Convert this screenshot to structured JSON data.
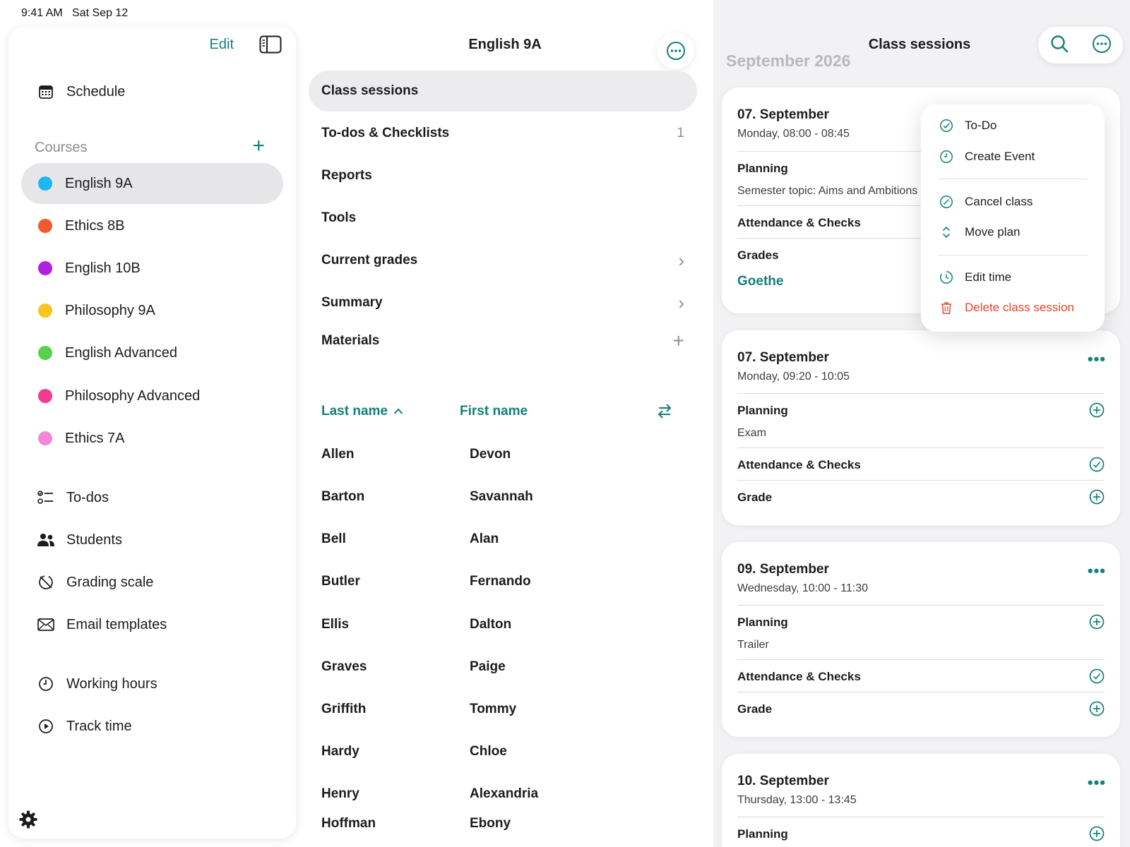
{
  "status": {
    "time": "9:41 AM",
    "date": "Sat Sep 12"
  },
  "sidebar": {
    "edit_label": "Edit",
    "schedule_label": "Schedule",
    "courses_heading": "Courses",
    "add_symbol": "+",
    "courses": [
      {
        "label": "English 9A",
        "color": "#1fb6f5"
      },
      {
        "label": "Ethics 8B",
        "color": "#f15a2e"
      },
      {
        "label": "English 10B",
        "color": "#b21fe0"
      },
      {
        "label": "Philosophy 9A",
        "color": "#f8c51b"
      },
      {
        "label": "English Advanced",
        "color": "#57d04b"
      },
      {
        "label": "Philosophy Advanced",
        "color": "#f13b8c"
      },
      {
        "label": "Ethics 7A",
        "color": "#f586d9"
      }
    ],
    "tools": [
      {
        "label": "To-dos",
        "icon": "checklist-icon"
      },
      {
        "label": "Students",
        "icon": "people-icon"
      },
      {
        "label": "Grading scale",
        "icon": "grading-scale-icon"
      },
      {
        "label": "Email templates",
        "icon": "envelope-icon"
      }
    ],
    "time_items": [
      {
        "label": "Working hours",
        "icon": "clock-icon"
      },
      {
        "label": "Track time",
        "icon": "play-circle-icon"
      }
    ]
  },
  "middle": {
    "title": "English 9A",
    "menu": [
      {
        "label": "Class sessions",
        "trail": ""
      },
      {
        "label": "To-dos & Checklists",
        "trail": "1"
      },
      {
        "label": "Reports",
        "trail": ""
      },
      {
        "label": "Tools",
        "trail": ""
      },
      {
        "label": "Current grades",
        "trail": "›"
      },
      {
        "label": "Summary",
        "trail": "›"
      },
      {
        "label": "Materials",
        "trail": "+"
      }
    ],
    "columns": {
      "last_name": "Last name",
      "first_name": "First name"
    },
    "students": [
      {
        "last": "Allen",
        "first": "Devon"
      },
      {
        "last": "Barton",
        "first": "Savannah"
      },
      {
        "last": "Bell",
        "first": "Alan"
      },
      {
        "last": "Butler",
        "first": "Fernando"
      },
      {
        "last": "Ellis",
        "first": "Dalton"
      },
      {
        "last": "Graves",
        "first": "Paige"
      },
      {
        "last": "Griffith",
        "first": "Tommy"
      },
      {
        "last": "Hardy",
        "first": "Chloe"
      },
      {
        "last": "Henry",
        "first": "Alexandria"
      },
      {
        "last": "Hoffman",
        "first": "Ebony"
      }
    ]
  },
  "right": {
    "title": "Class sessions",
    "month": "September 2026",
    "sessions": [
      {
        "date": "07. September",
        "time": "Monday, 08:00 - 08:45",
        "planning_label": "Planning",
        "planning_note": "Semester topic: Aims and Ambitions",
        "attendance_label": "Attendance & Checks",
        "grade_label": "Grades",
        "grade_link": "Goethe"
      },
      {
        "date": "07. September",
        "time": "Monday, 09:20 - 10:05",
        "planning_label": "Planning",
        "planning_note": "Exam",
        "attendance_label": "Attendance & Checks",
        "grade_label": "Grade"
      },
      {
        "date": "09. September",
        "time": "Wednesday, 10:00 - 11:30",
        "planning_label": "Planning",
        "planning_note": "Trailer",
        "attendance_label": "Attendance & Checks",
        "grade_label": "Grade"
      },
      {
        "date": "10. September",
        "time": "Thursday, 13:00 - 13:45",
        "planning_label": "Planning"
      }
    ],
    "more_symbol": "•••"
  },
  "context_menu": {
    "items": [
      {
        "label": "To-Do",
        "icon": "check-circle-icon"
      },
      {
        "label": "Create Event",
        "icon": "clock-icon"
      },
      {
        "label": "Cancel class",
        "icon": "cancel-circle-icon"
      },
      {
        "label": "Move plan",
        "icon": "chevron-up-down-icon"
      },
      {
        "label": "Edit time",
        "icon": "timer-icon"
      },
      {
        "label": "Delete class session",
        "icon": "trash-icon"
      }
    ]
  },
  "colors": {
    "accent": "#14807a",
    "danger": "#e9452f",
    "selection": "#e6e6e9"
  }
}
